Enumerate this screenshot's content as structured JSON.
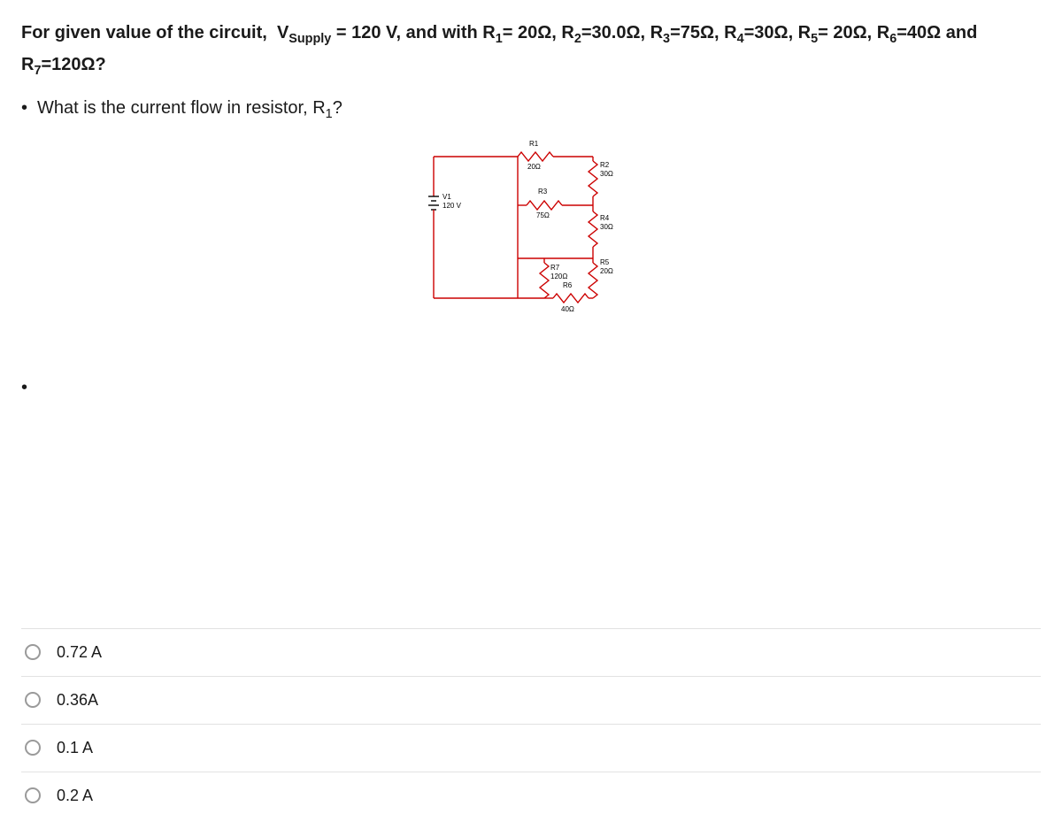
{
  "question": {
    "stem_html": "For given value of the circuit, &nbsp;V<sub>Supply</sub> = 120 V, and with R<sub>1</sub>= 20Ω, R<sub>2</sub>=30.0Ω, R<sub>3</sub>=75Ω, R<sub>4</sub>=30Ω, R<sub>5</sub>= 20Ω, R<sub>6</sub>=40Ω and R<sub>7</sub>=120Ω?",
    "sub_html": "What is the current flow in resistor, R<sub>1</sub>?"
  },
  "circuit": {
    "source": {
      "name": "V1",
      "value": "120 V"
    },
    "resistors": {
      "R1": "20Ω",
      "R2": "30Ω",
      "R3": "75Ω",
      "R4": "30Ω",
      "R5": "20Ω",
      "R6": "40Ω",
      "R7": "120Ω"
    }
  },
  "options": [
    {
      "label": "0.72 A"
    },
    {
      "label": "0.36A"
    },
    {
      "label": "0.1 A"
    },
    {
      "label": "0.2 A"
    }
  ]
}
